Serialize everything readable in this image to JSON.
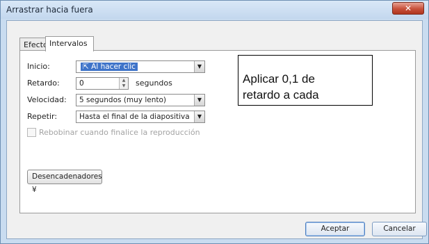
{
  "window": {
    "title": "Arrastrar hacia fuera",
    "close_glyph": "✕"
  },
  "tabs": [
    {
      "label": "Efecto",
      "active": false
    },
    {
      "label": "Intervalos",
      "active": true
    }
  ],
  "form": {
    "inicio": {
      "label": "Inicio:",
      "value": "Al hacer clic",
      "icon": "mouse-click-icon"
    },
    "retardo": {
      "label": "Retardo:",
      "value": "0",
      "unit": "segundos"
    },
    "velocidad": {
      "label": "Velocidad:",
      "value": "5 segundos (muy lento)"
    },
    "repetir": {
      "label": "Repetir:",
      "value": "Hasta el final de la diapositiva"
    },
    "rebobinar": {
      "label": "Rebobinar cuando finalice la reproducción",
      "checked": false
    },
    "triggers_label": "Desencadenadores ¥"
  },
  "callout": {
    "line1": "Aplicar 0,1 de",
    "line2": "retardo a cada"
  },
  "buttons": {
    "ok": "Aceptar",
    "cancel": "Cancelar"
  },
  "colors": {
    "selection": "#3f74c9",
    "titlebar": "#c3d7ee",
    "close": "#c7503a"
  }
}
